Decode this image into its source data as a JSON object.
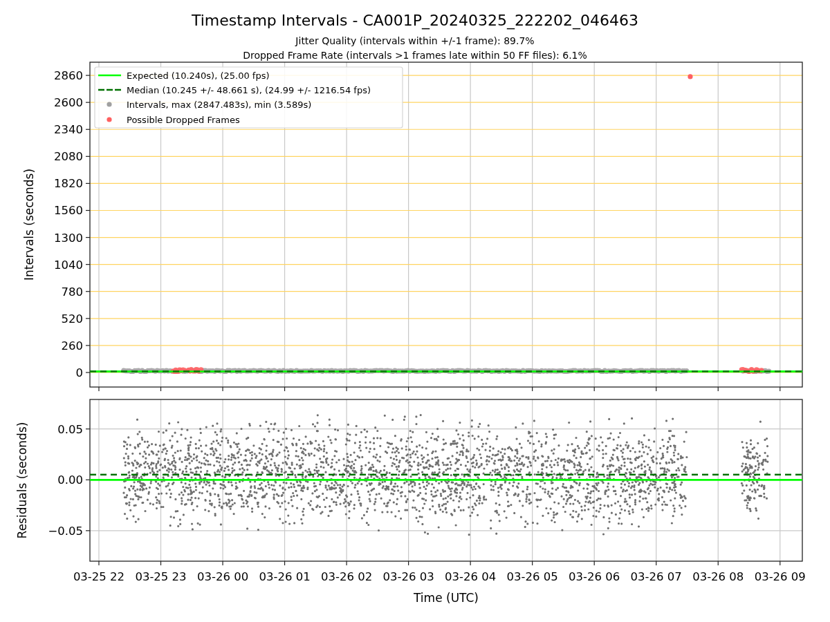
{
  "figure": {
    "title": "Timestamp Intervals - CA001P_20240325_222202_046463",
    "subtitles": [
      "Jitter Quality (intervals within +/-1 frame): 89.7%",
      "Dropped Frame Rate (intervals >1 frames late within 50 FF files): 6.1%"
    ]
  },
  "top_chart": {
    "legend": [
      {
        "label": "Expected (10.240s), (25.00 fps)",
        "kind": "line",
        "color": "#00ff00"
      },
      {
        "label": "Median (10.245 +/- 48.661 s), (24.99 +/- 1216.54 fps)",
        "kind": "dashed",
        "color": "#007000"
      },
      {
        "label": "Intervals, max (2847.483s), min (3.589s)",
        "kind": "dot",
        "color": "#a0a0a0"
      },
      {
        "label": "Possible Dropped Frames",
        "kind": "dot",
        "color": "#ff6060"
      }
    ],
    "chart_data": {
      "type": "scatter",
      "ylabel": "Intervals (seconds)",
      "grid": true,
      "categories": [
        null,
        null,
        null,
        null,
        null,
        null,
        null,
        null,
        null,
        null,
        null,
        null
      ],
      "ylim": [
        -140,
        2987
      ],
      "yticks": [
        {
          "value": 0,
          "label": "0"
        },
        {
          "value": 260,
          "label": "260"
        },
        {
          "value": 520,
          "label": "520"
        },
        {
          "value": 780,
          "label": "780"
        },
        {
          "value": 1040,
          "label": "1040"
        },
        {
          "value": 1300,
          "label": "1300"
        },
        {
          "value": 1560,
          "label": "1560"
        },
        {
          "value": 1820,
          "label": "1820"
        },
        {
          "value": 2080,
          "label": "2080"
        },
        {
          "value": 2340,
          "label": "2340"
        },
        {
          "value": 2600,
          "label": "2600"
        },
        {
          "value": 2860,
          "label": "2860"
        }
      ],
      "ref_lines": [
        {
          "axis": "y",
          "value": 10,
          "color": "#00ff00"
        },
        {
          "axis": "y",
          "value": 10,
          "color": "#007000"
        }
      ]
    }
  },
  "bottom_chart": {
    "chart_data": {
      "type": "scatter",
      "xlabel": "Time (UTC)",
      "ylabel": "Residuals (seconds)",
      "grid": true,
      "categories": [
        "03-25 22",
        "03-25 23",
        "03-26 00",
        "03-26 01",
        "03-26 02",
        "03-26 03",
        "03-26 04",
        "03-26 05",
        "03-26 06",
        "03-26 07",
        "03-26 08",
        "03-26 09"
      ],
      "ylim": [
        -0.08,
        0.079
      ],
      "yticks": [
        {
          "value": -0.05,
          "label": "−0.05"
        },
        {
          "value": 0,
          "label": "0.00"
        },
        {
          "value": 0.05,
          "label": "0.05"
        }
      ],
      "ref_lines": [
        {
          "axis": "y",
          "value": 0,
          "color": "#00ff00"
        },
        {
          "axis": "y",
          "value": 0.005,
          "color": "#007000"
        }
      ]
    }
  }
}
